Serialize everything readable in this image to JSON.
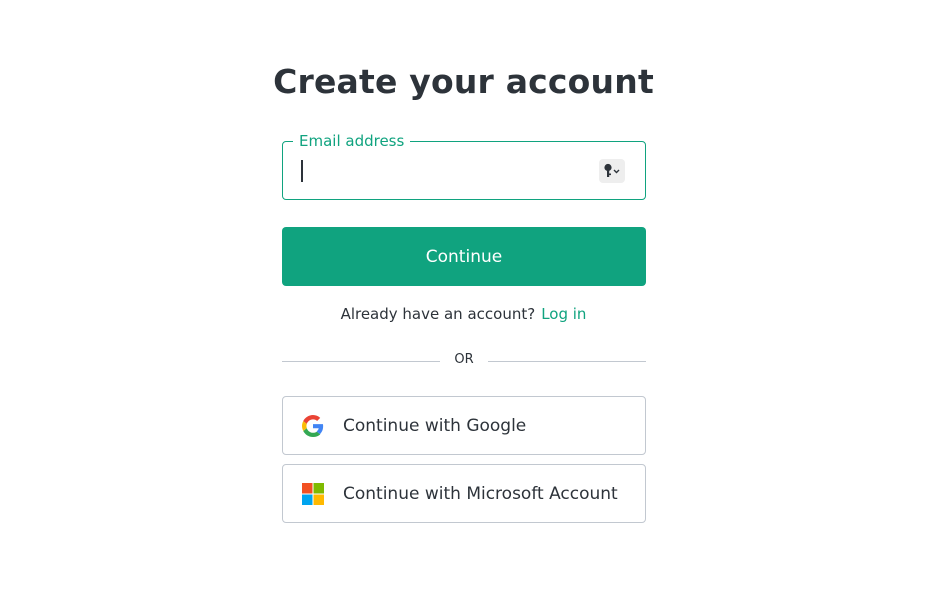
{
  "heading": {
    "title": "Create your account"
  },
  "email_field": {
    "label": "Email address",
    "value": "",
    "placeholder": ""
  },
  "continue_button": {
    "label": "Continue"
  },
  "login_prompt": {
    "text": "Already have an account?",
    "link_label": "Log in"
  },
  "divider": {
    "text": "OR"
  },
  "social": {
    "google": {
      "label": "Continue with Google",
      "icon": "google-logo-icon"
    },
    "microsoft": {
      "label": "Continue with Microsoft Account",
      "icon": "microsoft-logo-icon"
    }
  },
  "colors": {
    "accent": "#10a37f",
    "text": "#2d333a",
    "border": "#c2c8d0",
    "background": "#ffffff"
  }
}
